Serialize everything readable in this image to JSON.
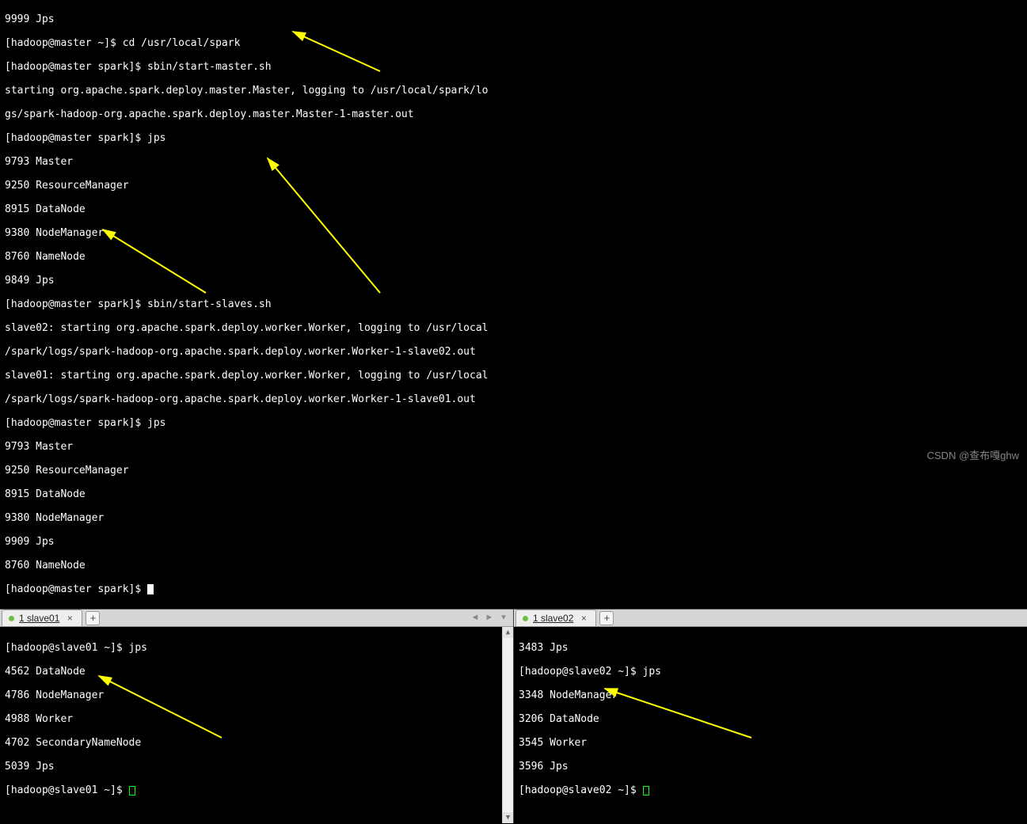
{
  "top_terminal": {
    "lines": [
      "9999 Jps",
      "[hadoop@master ~]$ cd /usr/local/spark",
      "[hadoop@master spark]$ sbin/start-master.sh",
      "starting org.apache.spark.deploy.master.Master, logging to /usr/local/spark/lo",
      "gs/spark-hadoop-org.apache.spark.deploy.master.Master-1-master.out",
      "[hadoop@master spark]$ jps",
      "9793 Master",
      "9250 ResourceManager",
      "8915 DataNode",
      "9380 NodeManager",
      "8760 NameNode",
      "9849 Jps",
      "[hadoop@master spark]$ sbin/start-slaves.sh",
      "slave02: starting org.apache.spark.deploy.worker.Worker, logging to /usr/local",
      "/spark/logs/spark-hadoop-org.apache.spark.deploy.worker.Worker-1-slave02.out",
      "slave01: starting org.apache.spark.deploy.worker.Worker, logging to /usr/local",
      "/spark/logs/spark-hadoop-org.apache.spark.deploy.worker.Worker-1-slave01.out",
      "[hadoop@master spark]$ jps",
      "9793 Master",
      "9250 ResourceManager",
      "8915 DataNode",
      "9380 NodeManager",
      "9909 Jps",
      "8760 NameNode",
      "[hadoop@master spark]$ "
    ]
  },
  "left_pane": {
    "tab_label": "1 slave01",
    "lines": [
      "[hadoop@slave01 ~]$ jps",
      "4562 DataNode",
      "4786 NodeManager",
      "4988 Worker",
      "4702 SecondaryNameNode",
      "5039 Jps",
      "[hadoop@slave01 ~]$ "
    ]
  },
  "right_pane": {
    "tab_label": "1 slave02",
    "lines": [
      "3483 Jps",
      "[hadoop@slave02 ~]$ jps",
      "3348 NodeManager",
      "3206 DataNode",
      "3545 Worker",
      "3596 Jps",
      "[hadoop@slave02 ~]$ "
    ]
  },
  "watermark": "CSDN @查布嘎ghw"
}
